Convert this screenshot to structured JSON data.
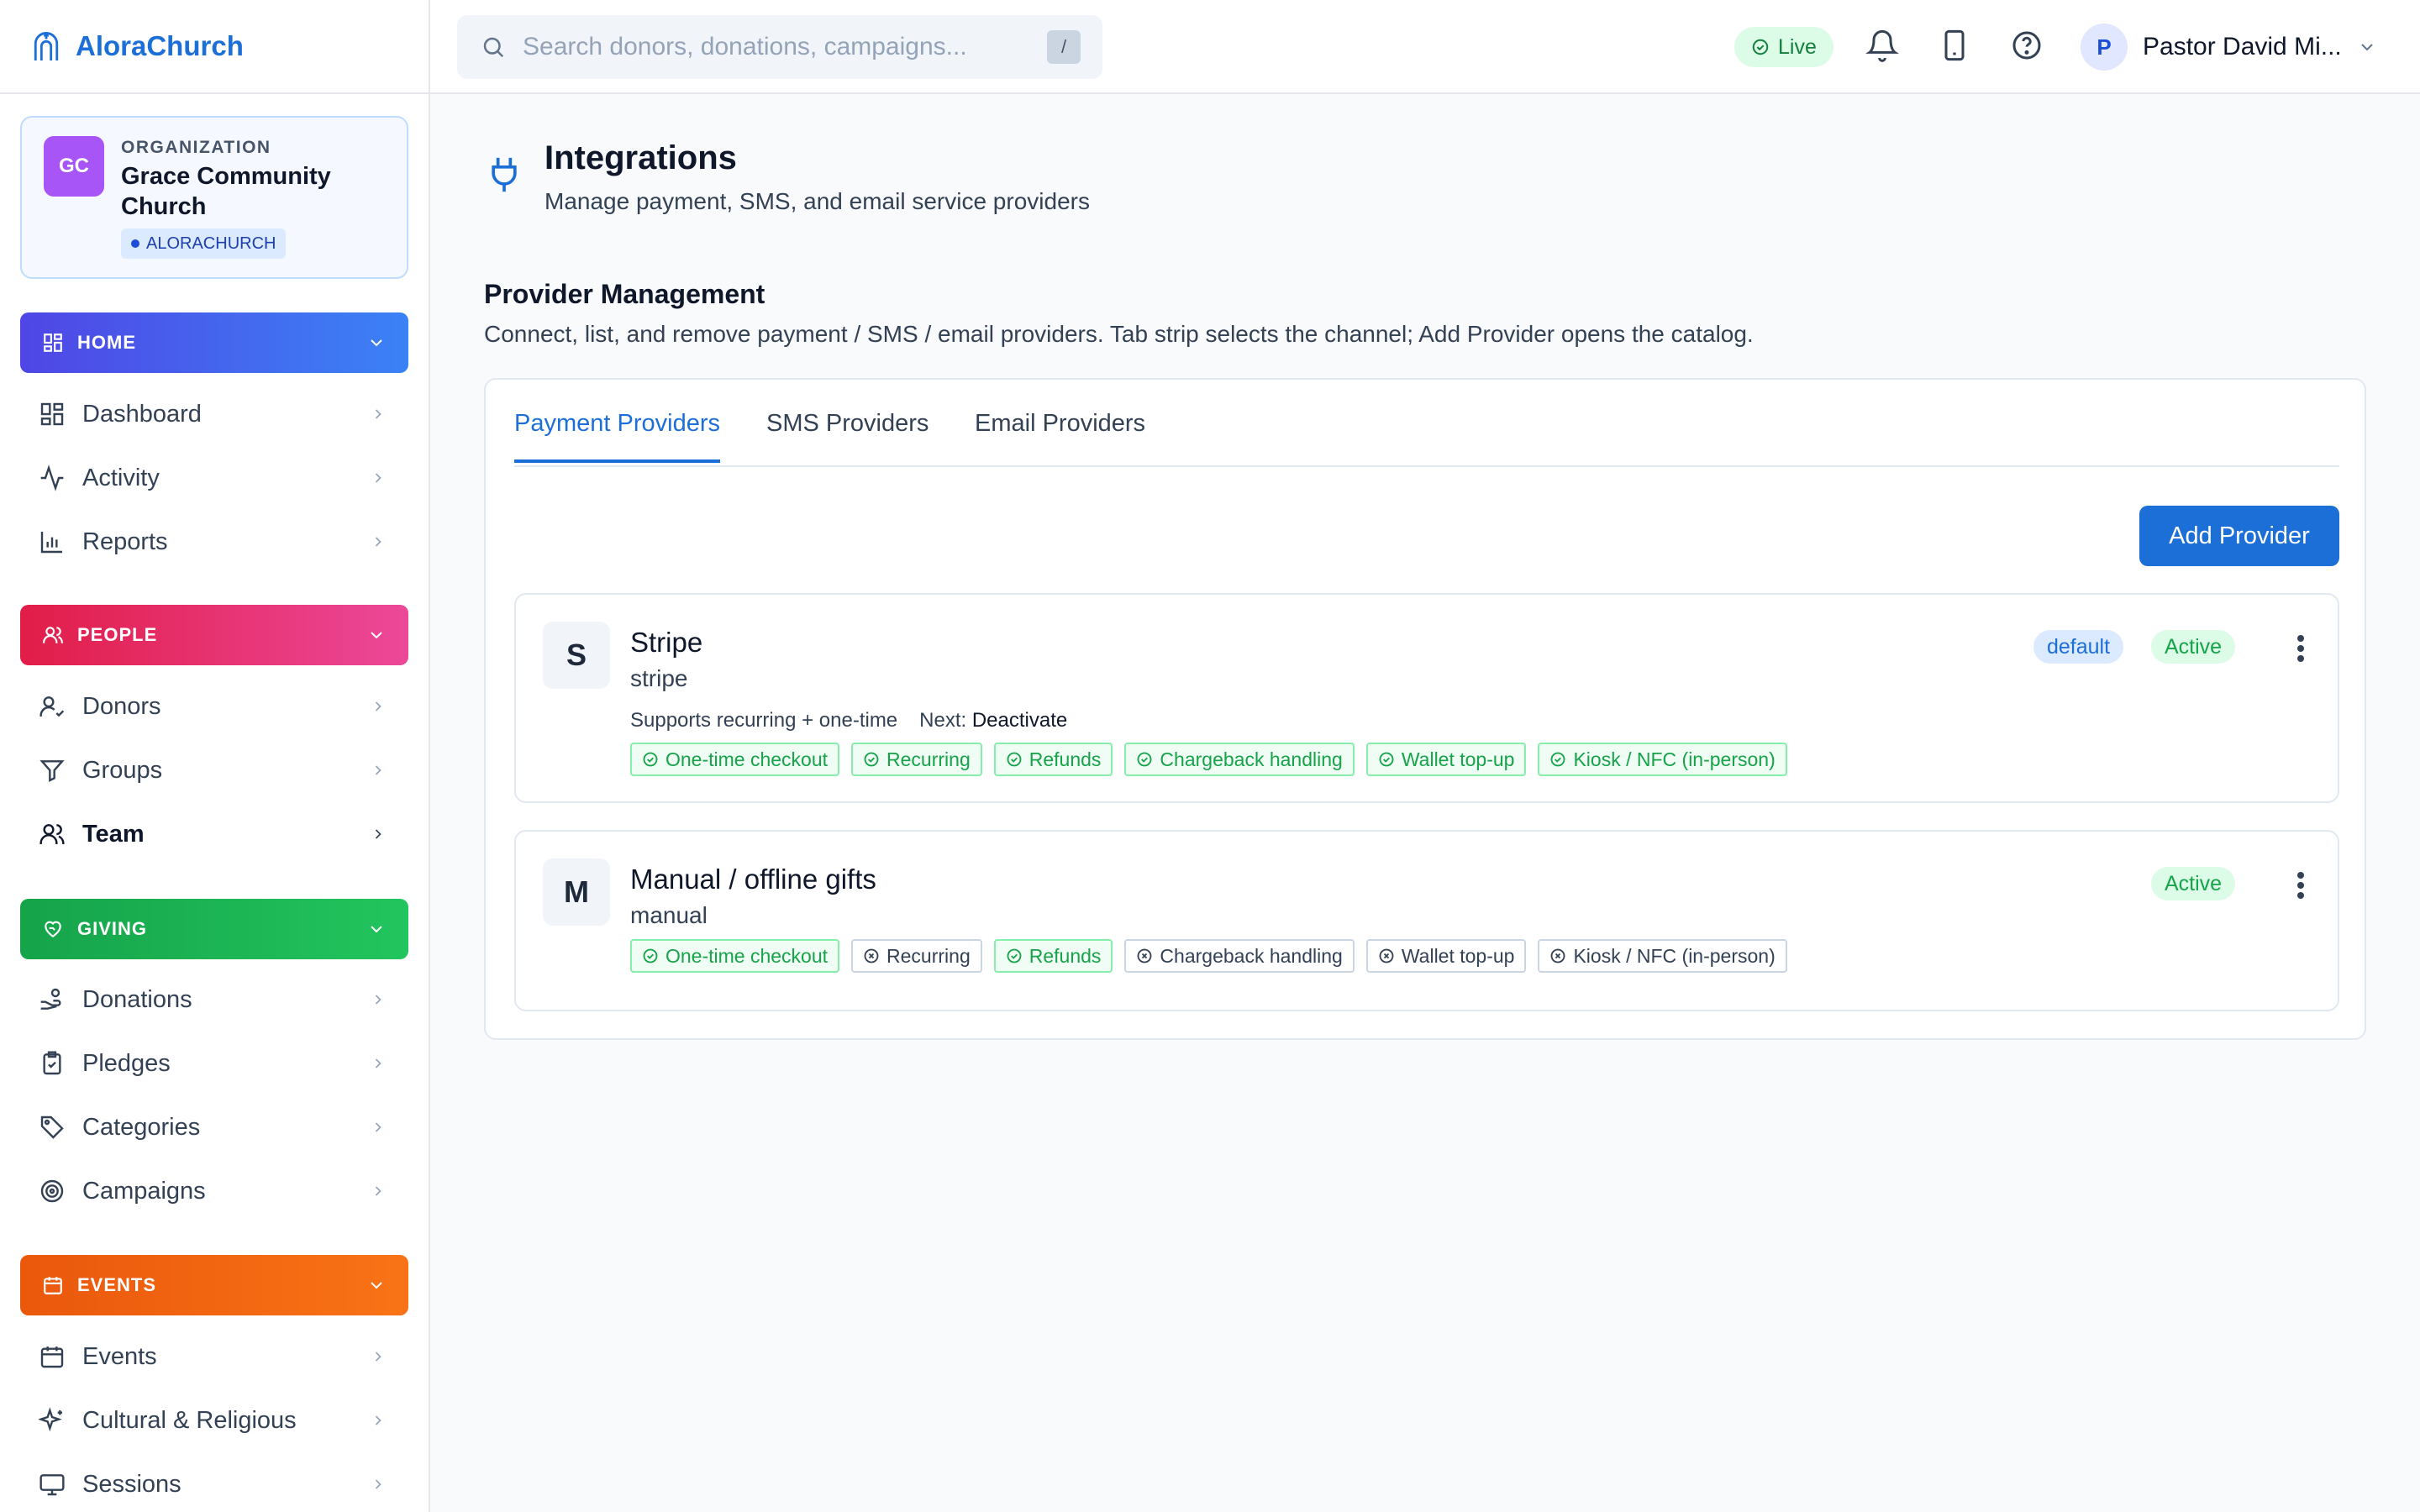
{
  "sidebar": {
    "brand": "AloraChurch",
    "org": {
      "label": "ORGANIZATION",
      "initials": "GC",
      "name": "Grace Community Church",
      "tag": "ALORACHURCH"
    },
    "sections": {
      "home": "HOME",
      "people": "PEOPLE",
      "giving": "GIVING",
      "events": "EVENTS"
    },
    "items": {
      "dashboard": "Dashboard",
      "activity": "Activity",
      "reports": "Reports",
      "donors": "Donors",
      "groups": "Groups",
      "team": "Team",
      "donations": "Donations",
      "pledges": "Pledges",
      "categories": "Categories",
      "campaigns": "Campaigns",
      "events": "Events",
      "cultural": "Cultural & Religious",
      "sessions": "Sessions"
    }
  },
  "topbar": {
    "search_placeholder": "Search donors, donations, campaigns...",
    "search_shortcut": "/",
    "live": "Live",
    "user_initial": "P",
    "user_name": "Pastor David Mi..."
  },
  "page": {
    "title": "Integrations",
    "subtitle": "Manage payment, SMS, and email service providers",
    "section_title": "Provider Management",
    "section_desc": "Connect, list, and remove payment / SMS / email providers. Tab strip selects the channel; Add Provider opens the catalog."
  },
  "tabs": {
    "payment": "Payment Providers",
    "sms": "SMS Providers",
    "email": "Email Providers",
    "active": "payment"
  },
  "add_provider": "Add Provider",
  "providers": [
    {
      "initial": "S",
      "name": "Stripe",
      "slug": "stripe",
      "supports": "Supports recurring + one-time",
      "next_label": "Next:",
      "next_action": "Deactivate",
      "default_badge": "default",
      "status": "Active",
      "capabilities": [
        {
          "label": "One-time checkout",
          "enabled": true
        },
        {
          "label": "Recurring",
          "enabled": true
        },
        {
          "label": "Refunds",
          "enabled": true
        },
        {
          "label": "Chargeback handling",
          "enabled": true
        },
        {
          "label": "Wallet top-up",
          "enabled": true
        },
        {
          "label": "Kiosk / NFC (in-person)",
          "enabled": true
        }
      ]
    },
    {
      "initial": "M",
      "name": "Manual / offline gifts",
      "slug": "manual",
      "status": "Active",
      "capabilities": [
        {
          "label": "One-time checkout",
          "enabled": true
        },
        {
          "label": "Recurring",
          "enabled": false
        },
        {
          "label": "Refunds",
          "enabled": true
        },
        {
          "label": "Chargeback handling",
          "enabled": false
        },
        {
          "label": "Wallet top-up",
          "enabled": false
        },
        {
          "label": "Kiosk / NFC (in-person)",
          "enabled": false
        }
      ]
    }
  ],
  "colors": {
    "brand": "#1d6fd8",
    "home_gradient": [
      "#4f46e5",
      "#3b82f6"
    ],
    "people_gradient": [
      "#e11d48",
      "#ec4899"
    ],
    "giving_gradient": [
      "#16a34a",
      "#22c55e"
    ],
    "events_gradient": [
      "#ea580c",
      "#f97316"
    ],
    "active_green": "#16a34a"
  }
}
